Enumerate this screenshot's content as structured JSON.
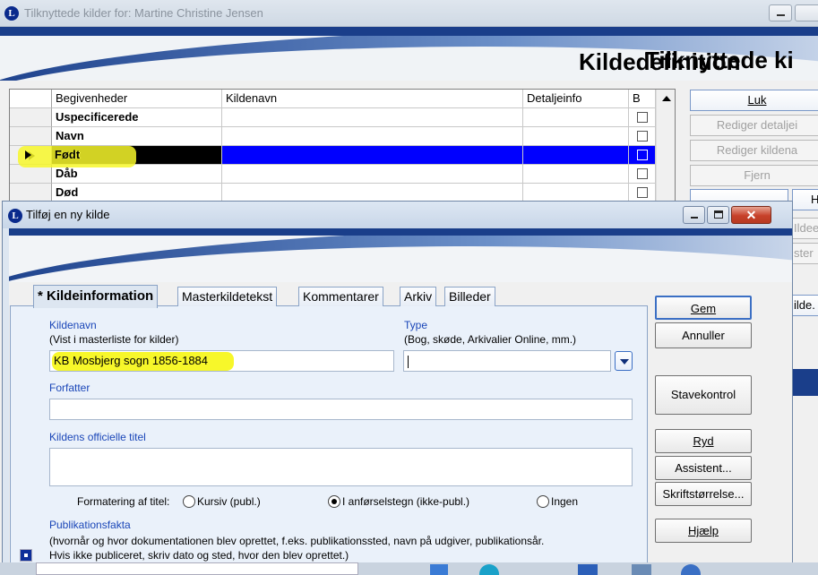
{
  "back_window": {
    "title": "Tilknyttede kilder for: Martine Christine Jensen",
    "heading": "Tilknyttede ki",
    "grid": {
      "columns": [
        "Begivenheder",
        "Kildenavn",
        "Detaljeinfo",
        "B"
      ],
      "rows": [
        {
          "event": "Uspecificerede",
          "source": "",
          "detail": "",
          "checked": false
        },
        {
          "event": "Navn",
          "source": "",
          "detail": "",
          "checked": false
        },
        {
          "event": "Født",
          "source": "",
          "detail": "",
          "checked": false,
          "current": true
        },
        {
          "event": "Dåb",
          "source": "",
          "detail": "",
          "checked": false
        },
        {
          "event": "Død",
          "source": "",
          "detail": "",
          "checked": false
        }
      ]
    },
    "buttons": {
      "luk": "Luk",
      "rediger_detaljer": "Rediger detaljei",
      "rediger_kildenavn": "Rediger kildena",
      "fjern": "Fjern",
      "partial_1": "Ildee",
      "partial_2": "ster",
      "partial_3": "ilde.",
      "partial_h": "H"
    }
  },
  "dialog": {
    "title": "Tilføj en ny kilde",
    "heading": "Kildedefinition",
    "tabs": [
      {
        "label": "* Kildeinformation",
        "active": true
      },
      {
        "label": "Masterkildetekst",
        "active": false
      },
      {
        "label": "Kommentarer",
        "active": false
      },
      {
        "label": "Arkiv",
        "active": false
      },
      {
        "label": "Billeder",
        "active": false
      }
    ],
    "form": {
      "kildenavn_label": "Kildenavn",
      "kildenavn_hint": "(Vist i masterliste for kilder)",
      "kildenavn_value": "KB Mosbjerg sogn 1856-1884",
      "type_label": "Type",
      "type_hint": "(Bog, skøde, Arkivalier Online, mm.)",
      "type_value": "",
      "forfatter_label": "Forfatter",
      "forfatter_value": "",
      "titel_label": "Kildens officielle titel",
      "titel_value": "",
      "formatering_label": "Formatering af titel:",
      "radio_kursiv": "Kursiv (publ.)",
      "radio_anfoerselstegn": "I anførselstegn (ikke-publ.)",
      "radio_ingen": "Ingen",
      "radio_selected": "anfoerselstegn",
      "pub_label": "Publikationsfakta",
      "pub_hint_1": "(hvornår og hvor dokumentationen blev oprettet, f.eks. publikationssted, navn på udgiver, publikationsår.",
      "pub_hint_2": "Hvis ikke publiceret, skriv dato og sted, hvor den blev oprettet.)"
    },
    "buttons": {
      "gem": "Gem",
      "annuller": "Annuller",
      "stavekontrol": "Stavekontrol",
      "ryd": "Ryd",
      "assistent": "Assistent...",
      "skriftstoerrelse": "Skriftstørrelse...",
      "hjaelp": "Hjælp"
    }
  },
  "colors": {
    "selection_row": "#0000ff",
    "highlight": "#f7f72a",
    "label_blue": "#1a46b8",
    "banner_dark": "#1a3e8a"
  }
}
